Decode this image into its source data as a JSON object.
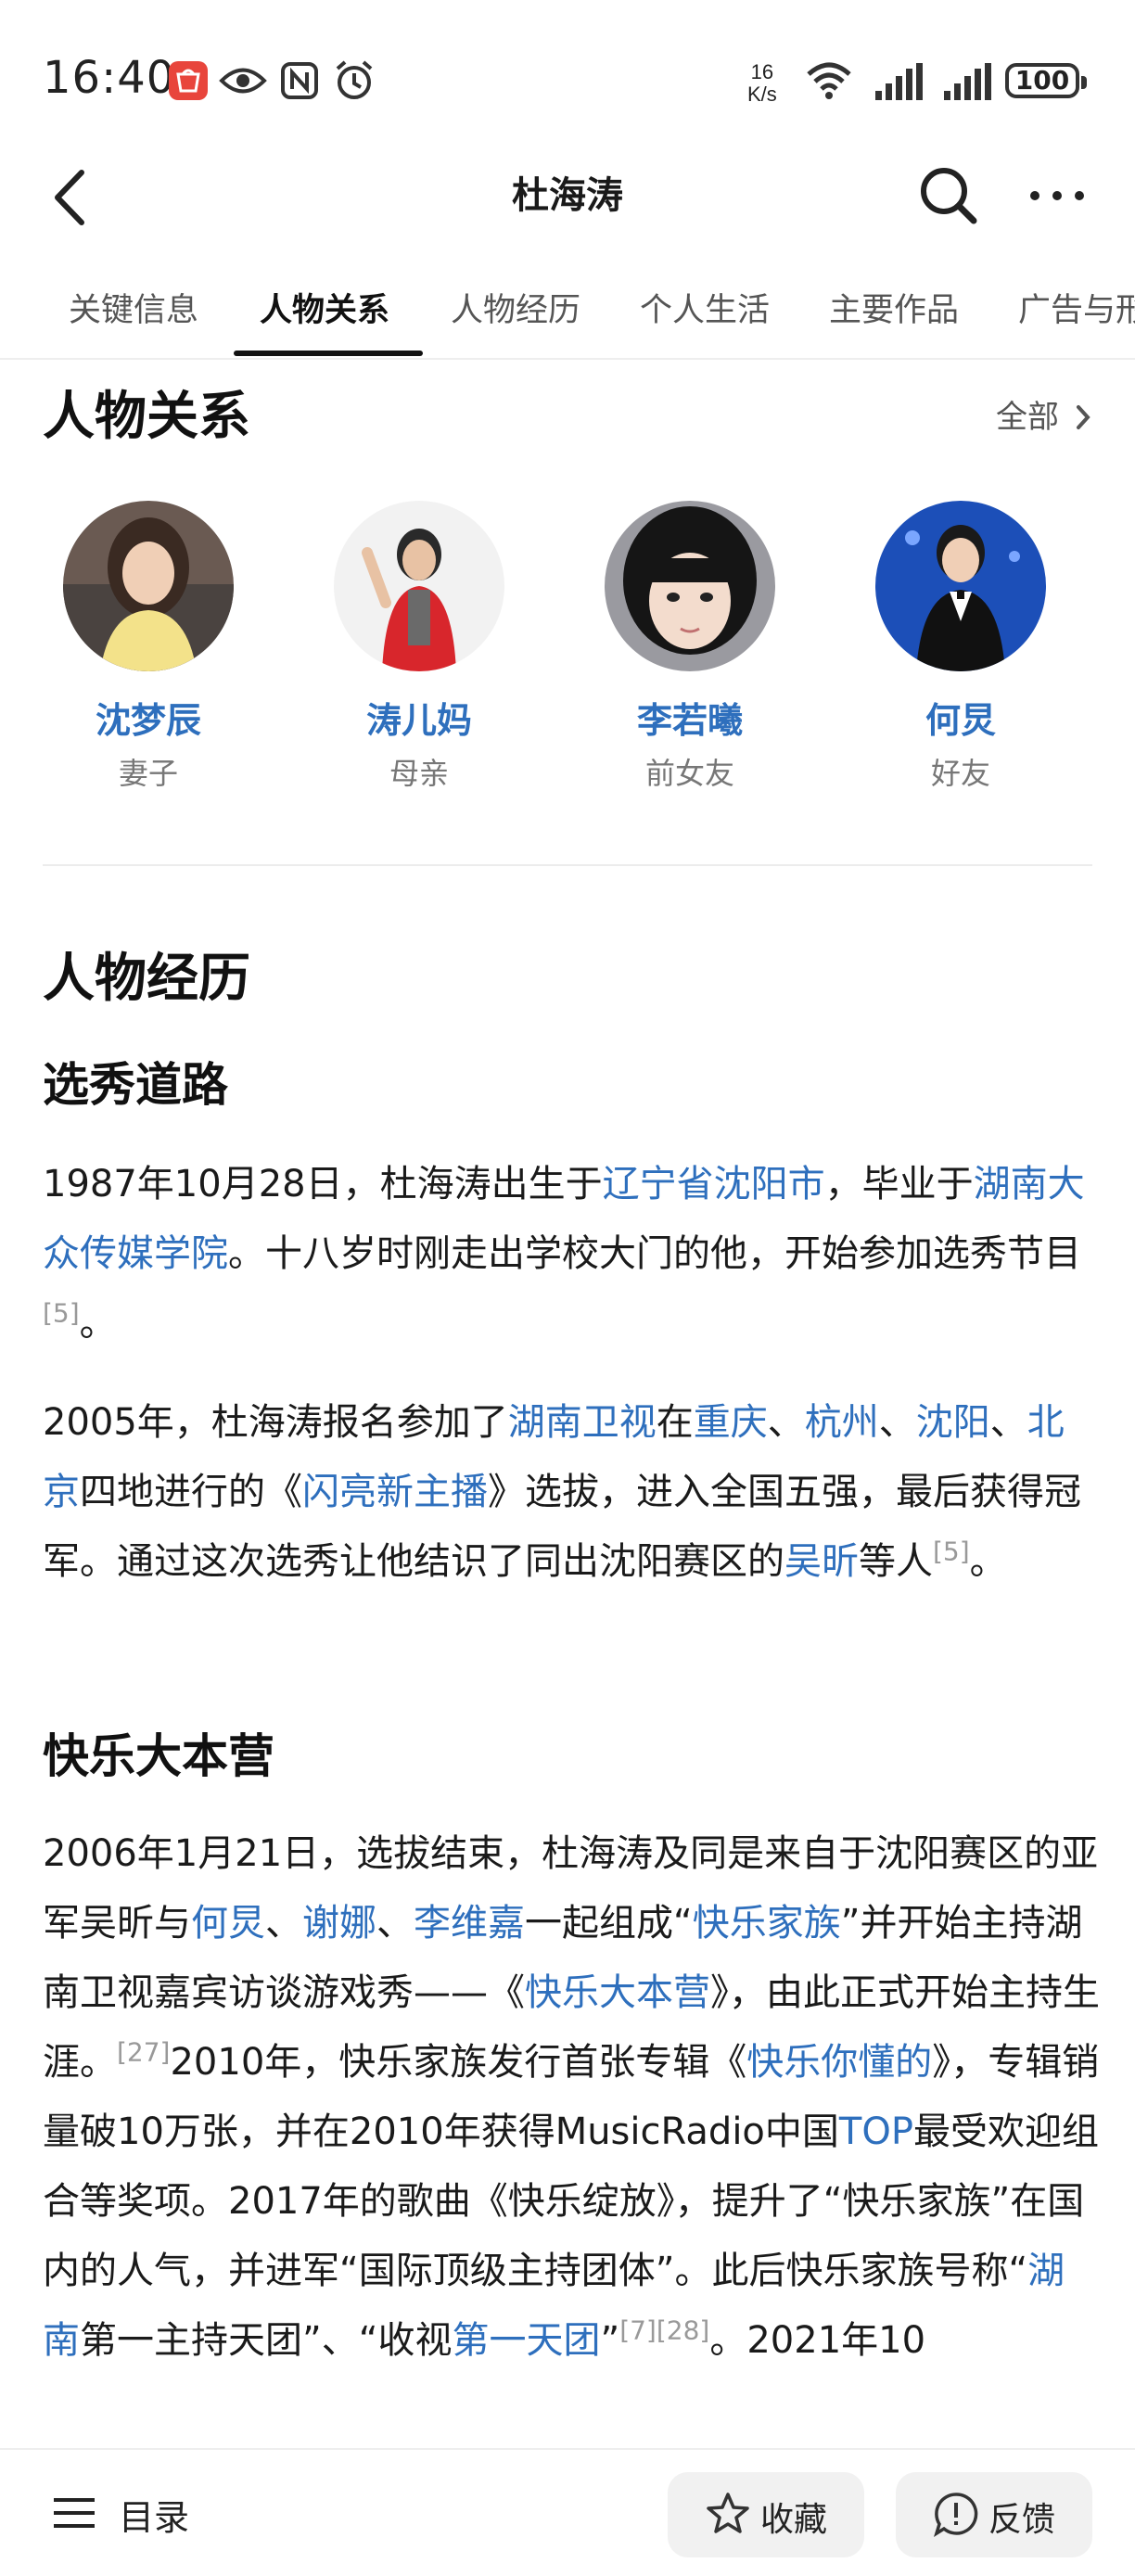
{
  "status_bar": {
    "time": "16:40",
    "net_speed_value": "16",
    "net_speed_unit": "K/s",
    "battery": "100",
    "icons": [
      "huawei-app-icon",
      "eye-icon",
      "nfc-icon",
      "alarm-icon",
      "wifi-icon",
      "signal-icon",
      "signal-icon"
    ]
  },
  "nav": {
    "title": "杜海涛"
  },
  "tabs": [
    "关键信息",
    "人物关系",
    "人物经历",
    "个人生活",
    "主要作品",
    "广告与形"
  ],
  "active_tab_index": 1,
  "relations": {
    "heading": "人物关系",
    "all_label": "全部",
    "people": [
      {
        "name": "沈梦辰",
        "relation": "妻子"
      },
      {
        "name": "涛儿妈",
        "relation": "母亲"
      },
      {
        "name": "李若曦",
        "relation": "前女友"
      },
      {
        "name": "何炅",
        "relation": "好友"
      }
    ]
  },
  "experience": {
    "heading": "人物经历",
    "sub1": "选秀道路",
    "p1": {
      "a": "1987年10月28日，杜海涛出生于",
      "l1": "辽宁省沈阳市",
      "b": "，毕业于",
      "l2": "湖南大众传媒学院",
      "c": "。十八岁时刚走出学校大门的他，开始参加选秀节目",
      "r1": "[5]",
      "d": "。"
    },
    "p2": {
      "a": "2005年，杜海涛报名参加了",
      "l1": "湖南卫视",
      "b": "在",
      "l2": "重庆",
      "c": "、",
      "l3": "杭州",
      "d": "、",
      "l4": "沈阳",
      "e": "、",
      "l5": "北京",
      "f": "四地进行的《",
      "l6": "闪亮新主播",
      "g": "》选拔，进入全国五强，最后获得冠军。通过这次选秀让他结识了同出沈阳赛区的",
      "l7": "吴昕",
      "h": "等人",
      "r1": "[5]",
      "i": "。"
    },
    "sub2": "快乐大本营",
    "p3": {
      "a": "2006年1月21日，选拔结束，杜海涛及同是来自于沈阳赛区的亚军吴昕与",
      "l1": "何炅",
      "b": "、",
      "l2": "谢娜",
      "c": "、",
      "l3": "李维嘉",
      "d": "一起组成“",
      "l4": "快乐家族",
      "e": "”并开始主持湖南卫视嘉宾访谈游戏秀——《",
      "l5": "快乐大本营",
      "f": "》，由此正式开始主持生涯。",
      "r1": "[27]",
      "g": "2010年，快乐家族发行首张专辑《",
      "l6": "快乐你懂的",
      "h": "》，专辑销量破10万张，并在2010年获得MusicRadio中国",
      "l7": "TOP",
      "i": "最受欢迎组合等奖项。2017年的歌曲《快乐绽放》，提升了“快乐家族”在国内的人气，并进军“国际顶级主持团体”。此后快乐家族号称“",
      "l8": "湖南",
      "j": "第一主持天团”、“收视",
      "l9": "第一天团",
      "k": "”",
      "r2": "[7]",
      "r3": "[28]",
      "m": "。2021年10"
    }
  },
  "bottom_bar": {
    "toc_label": "目录",
    "collect_label": "收藏",
    "feedback_label": "反馈"
  },
  "colors": {
    "link": "#2e6fbd",
    "text": "#1a1a1a",
    "muted": "#777777"
  }
}
